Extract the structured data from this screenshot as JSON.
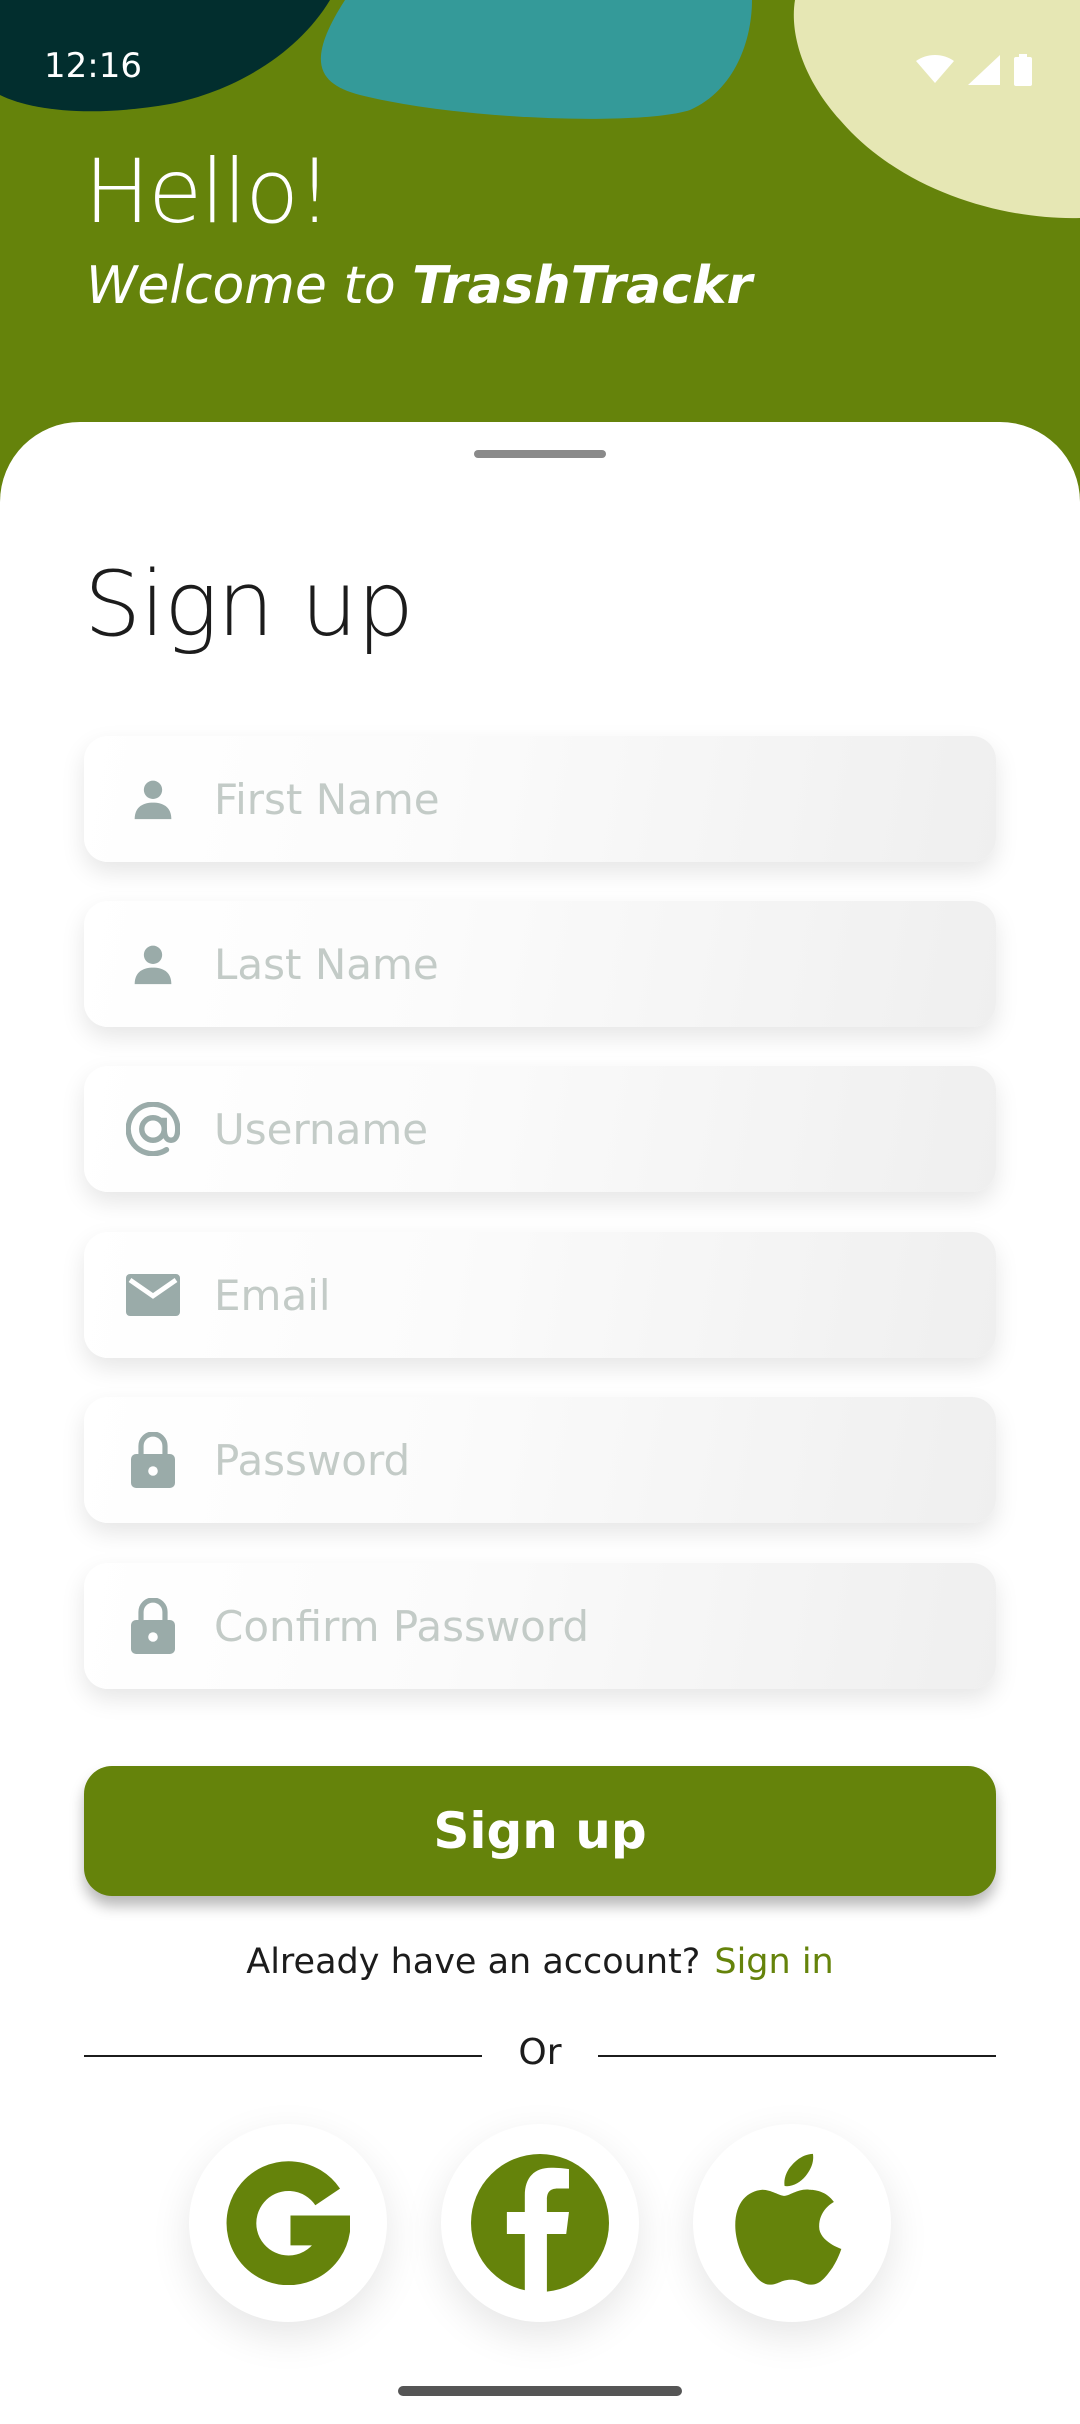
{
  "status_bar": {
    "time": "12:16",
    "icons": [
      "wifi-icon",
      "signal-icon",
      "battery-icon"
    ]
  },
  "header": {
    "greeting": "Hello!",
    "welcome_prefix": "Welcome to",
    "app_name": "TrashTrackr"
  },
  "form": {
    "title": "Sign up",
    "fields": [
      {
        "placeholder": "First Name",
        "value": "",
        "icon": "person-icon"
      },
      {
        "placeholder": "Last Name",
        "value": "",
        "icon": "person-icon"
      },
      {
        "placeholder": "Username",
        "value": "",
        "icon": "at-icon"
      },
      {
        "placeholder": "Email",
        "value": "",
        "icon": "email-icon"
      },
      {
        "placeholder": "Password",
        "value": "",
        "icon": "lock-icon"
      },
      {
        "placeholder": "Confirm Password",
        "value": "",
        "icon": "lock-icon"
      }
    ],
    "submit_label": "Sign up",
    "already_text": "Already have an account?",
    "signin_link": "Sign in",
    "or_text": "Or"
  },
  "social": [
    {
      "name": "google",
      "icon": "google-icon"
    },
    {
      "name": "facebook",
      "icon": "facebook-icon"
    },
    {
      "name": "apple",
      "icon": "apple-icon"
    }
  ],
  "colors": {
    "brand": "#65830b",
    "header_dark": "#022e2e",
    "header_teal": "#349a99",
    "header_cream": "#e6e7b4",
    "icon_gray": "#9aaba9",
    "placeholder": "#c3cbc7"
  }
}
